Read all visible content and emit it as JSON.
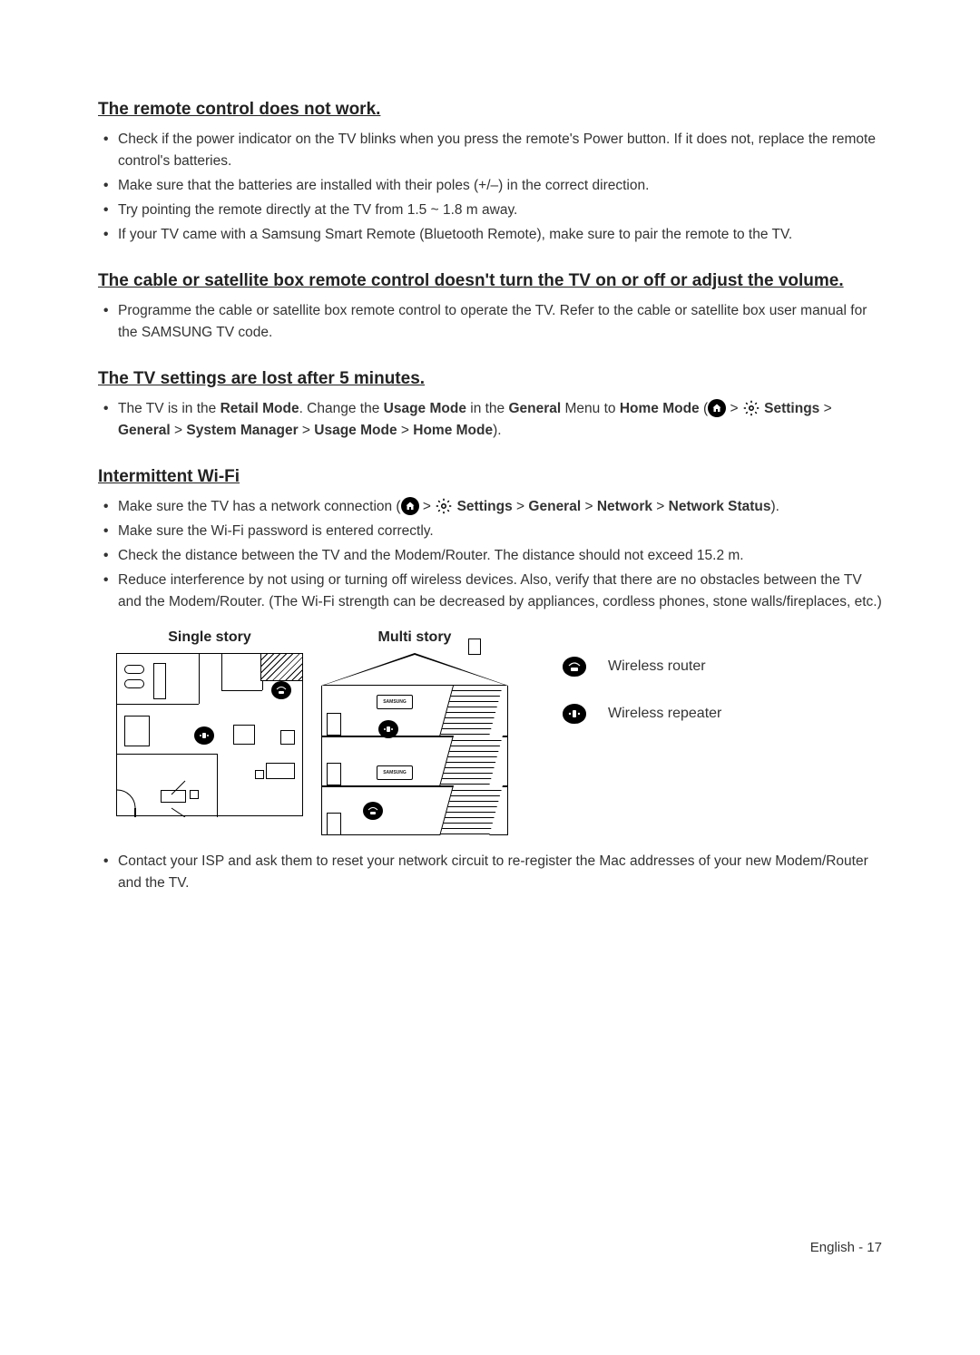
{
  "sections": {
    "s1": {
      "heading": "The remote control does not work.",
      "items": {
        "i1": "Check if the power indicator on the TV blinks when you press the remote's Power button. If it does not, replace the remote control's batteries.",
        "i2": "Make sure that the batteries are installed with their poles (+/–) in the correct direction.",
        "i3": "Try pointing the remote directly at the TV from 1.5 ~ 1.8 m away.",
        "i4": "If your TV came with a Samsung Smart Remote (Bluetooth Remote), make sure to pair the remote to the TV."
      }
    },
    "s2": {
      "heading": "The cable or satellite box remote control doesn't turn the TV on or off or adjust the volume.",
      "items": {
        "i1": "Programme the cable or satellite box remote control to operate the TV. Refer to the cable or satellite box user manual for the SAMSUNG TV code."
      }
    },
    "s3": {
      "heading": "The TV settings are lost after 5 minutes.",
      "items": {
        "i1": {
          "pre": "The TV is in the ",
          "retail": "Retail Mode",
          "mid1": ". Change the ",
          "usage": "Usage Mode",
          "mid2": " in the ",
          "general": "General",
          "mid3": " Menu to ",
          "home": "Home Mode",
          "open": " (",
          "sep": " > ",
          "settings": "Settings",
          "general2": "General",
          "sysmgr": "System Manager",
          "usage2": "Usage Mode",
          "home2": "Home Mode",
          "close": ")."
        }
      }
    },
    "s4": {
      "heading": "Intermittent Wi-Fi",
      "items": {
        "i1": {
          "pre": "Make sure the TV has a network connection (",
          "sep": " > ",
          "settings": "Settings",
          "general": "General",
          "network": "Network",
          "status": "Network Status",
          "close": ")."
        },
        "i2": "Make sure the Wi-Fi password is entered correctly.",
        "i3": "Check the distance between the TV and the Modem/Router. The distance should not exceed 15.2 m.",
        "i4": "Reduce interference by not using or turning off wireless devices. Also, verify that there are no obstacles between the TV and the Modem/Router. (The Wi-Fi strength can be decreased by appliances, cordless phones, stone walls/fireplaces, etc.)",
        "i5": "Contact your ISP and ask them to reset your network circuit to re-register the Mac addresses of your new Modem/Router and the TV."
      }
    }
  },
  "diagram": {
    "single_title": "Single story",
    "multi_title": "Multi story",
    "tv_label": "SAMSUNG",
    "legend": {
      "router": "Wireless router",
      "repeater": "Wireless repeater"
    }
  },
  "footer": "English - 17"
}
